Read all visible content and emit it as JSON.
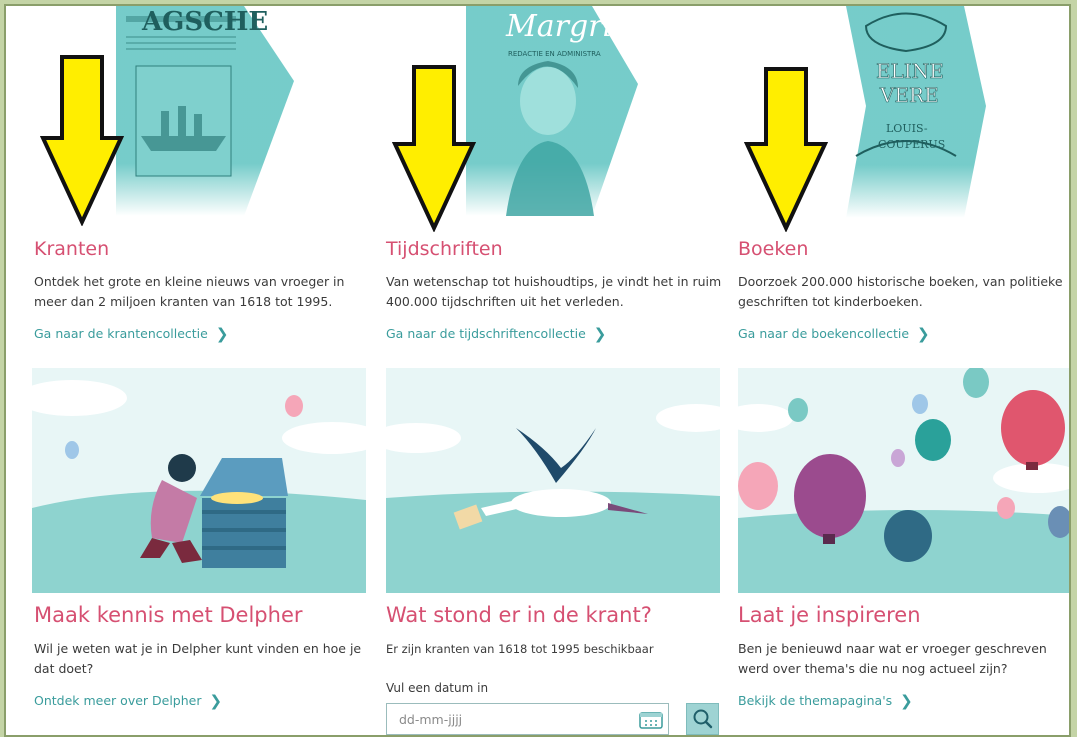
{
  "colors": {
    "accent_pink": "#d65072",
    "link_teal": "#3a9c9c",
    "arrow_yellow": "#ffee00",
    "sky": "#e8f6f6",
    "ground": "#8ed3cf"
  },
  "collections": [
    {
      "title": "Kranten",
      "description": "Ontdek het grote en kleine nieuws van vroeger in meer dan 2 miljoen kranten van 1618 tot 1995.",
      "link": "Ga naar de krantencollectie",
      "hero_text": "AGSCHE"
    },
    {
      "title": "Tijdschriften",
      "description": "Van wetenschap tot huishoudtips, je vindt het in ruim 400.000 tijdschriften uit het verleden.",
      "link": "Ga naar de tijdschriftencollectie",
      "hero_text": "Margriet",
      "hero_subtext": "REDACTIE EN ADMINISTRA"
    },
    {
      "title": "Boeken",
      "description": "Doorzoek 200.000 historische boeken, van politieke geschriften tot kinderboeken.",
      "link": "Ga naar de boekencollectie",
      "hero_text_1": "ELINE",
      "hero_text_2": "VERE",
      "hero_text_3": "LOUIS-",
      "hero_text_4": "COUPERUS"
    }
  ],
  "features": [
    {
      "title": "Maak kennis met Delpher",
      "description": "Wil je weten wat je in Delpher kunt vinden en hoe je dat doet?",
      "link": "Ontdek meer over Delpher"
    },
    {
      "title": "Wat stond er in de krant?",
      "description": "Er zijn kranten van 1618 tot 1995 beschikbaar",
      "date_label": "Vul een datum in",
      "date_placeholder": "dd-mm-jjjj"
    },
    {
      "title": "Laat je inspireren",
      "description": "Ben je benieuwd naar wat er vroeger geschreven werd over thema's die nu nog actueel zijn?",
      "link": "Bekijk de themapagina's"
    }
  ],
  "icons": {
    "chevron": "chevron-right-icon",
    "calendar": "calendar-icon",
    "search": "search-icon",
    "arrow": "down-arrow-icon"
  }
}
